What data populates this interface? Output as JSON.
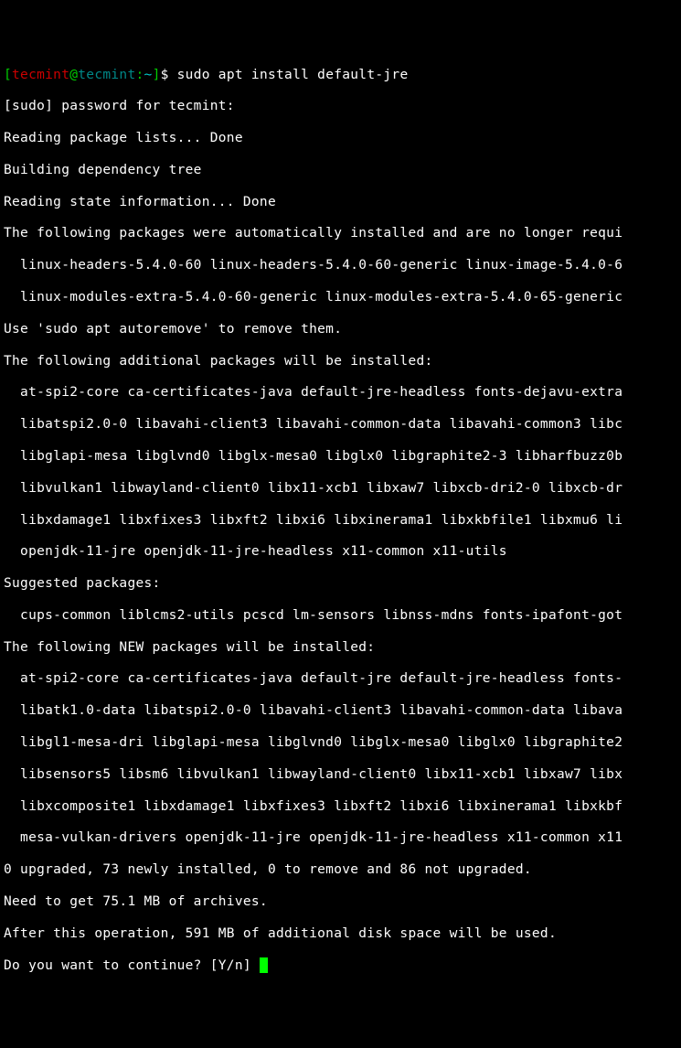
{
  "prompt": {
    "lbracket": "[",
    "user": "tecmint",
    "at": "@",
    "host": "tecmint",
    "colon": ":",
    "tilde": "~",
    "rbracket": "]",
    "dollar": "$",
    "command": " sudo apt install default-jre"
  },
  "lines": {
    "l01": "[sudo] password for tecmint: ",
    "l02": "Reading package lists... Done",
    "l03": "Building dependency tree       ",
    "l04": "Reading state information... Done",
    "l05": "The following packages were automatically installed and are no longer requi",
    "l06": "  linux-headers-5.4.0-60 linux-headers-5.4.0-60-generic linux-image-5.4.0-6",
    "l07": "  linux-modules-extra-5.4.0-60-generic linux-modules-extra-5.4.0-65-generic",
    "l08": "Use 'sudo apt autoremove' to remove them.",
    "l09": "The following additional packages will be installed:",
    "l10": "  at-spi2-core ca-certificates-java default-jre-headless fonts-dejavu-extra",
    "l11": "  libatspi2.0-0 libavahi-client3 libavahi-common-data libavahi-common3 libc",
    "l12": "  libglapi-mesa libglvnd0 libglx-mesa0 libglx0 libgraphite2-3 libharfbuzz0b",
    "l13": "  libvulkan1 libwayland-client0 libx11-xcb1 libxaw7 libxcb-dri2-0 libxcb-dr",
    "l14": "  libxdamage1 libxfixes3 libxft2 libxi6 libxinerama1 libxkbfile1 libxmu6 li",
    "l15": "  openjdk-11-jre openjdk-11-jre-headless x11-common x11-utils",
    "l16": "Suggested packages:",
    "l17": "  cups-common liblcms2-utils pcscd lm-sensors libnss-mdns fonts-ipafont-got",
    "l18": "The following NEW packages will be installed:",
    "l19": "  at-spi2-core ca-certificates-java default-jre default-jre-headless fonts-",
    "l20": "  libatk1.0-data libatspi2.0-0 libavahi-client3 libavahi-common-data libava",
    "l21": "  libgl1-mesa-dri libglapi-mesa libglvnd0 libglx-mesa0 libglx0 libgraphite2",
    "l22": "  libsensors5 libsm6 libvulkan1 libwayland-client0 libx11-xcb1 libxaw7 libx",
    "l23": "  libxcomposite1 libxdamage1 libxfixes3 libxft2 libxi6 libxinerama1 libxkbf",
    "l24": "  mesa-vulkan-drivers openjdk-11-jre openjdk-11-jre-headless x11-common x11",
    "l25": "0 upgraded, 73 newly installed, 0 to remove and 86 not upgraded.",
    "l26": "Need to get 75.1 MB of archives.",
    "l27": "After this operation, 591 MB of additional disk space will be used.",
    "l28": "Do you want to continue? [Y/n] "
  }
}
